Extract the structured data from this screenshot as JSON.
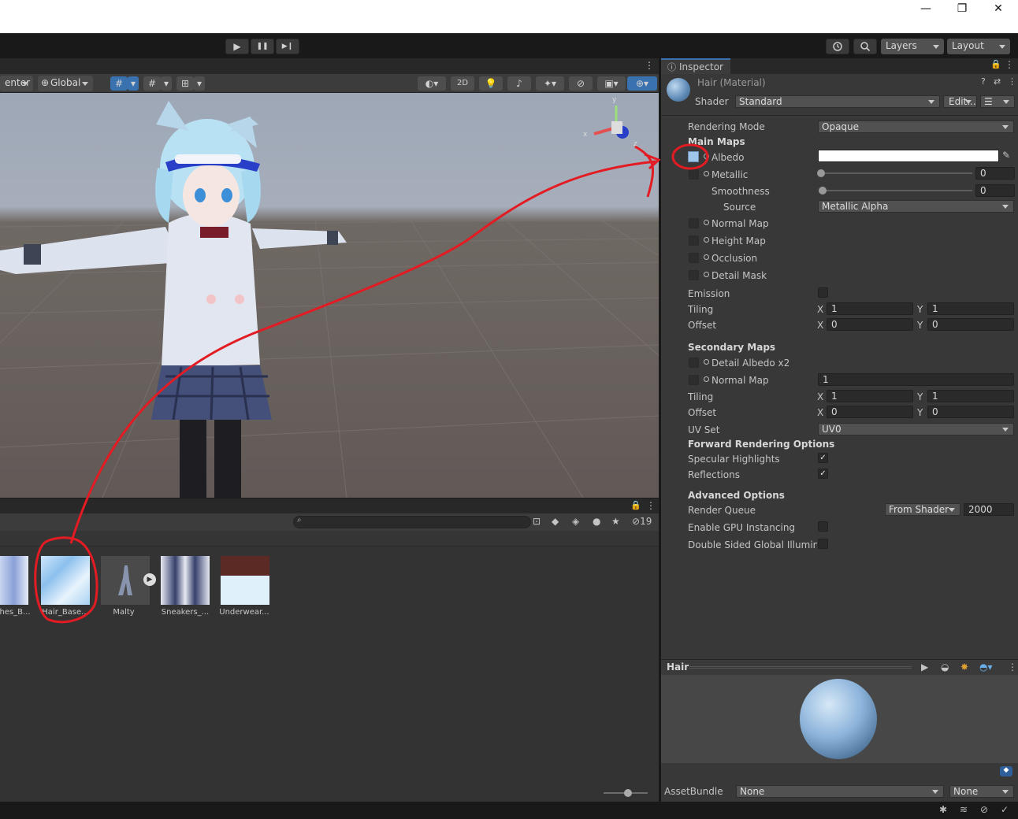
{
  "window": {
    "minimize": "—",
    "restore": "❐",
    "close": "✕"
  },
  "toolbar": {
    "play": "▶",
    "pause": "❚❚",
    "step": "▶❙",
    "history_icon": "history-icon",
    "search_icon": "search-icon",
    "layers": "Layers",
    "layout": "Layout"
  },
  "scene_toolbar": {
    "pivot": "enter",
    "global": "Global",
    "mode_2d": "2D",
    "axis_y": "y",
    "axis_x": "x",
    "axis_z": "z"
  },
  "project": {
    "search_placeholder": "",
    "hidden_count": "19",
    "assets": [
      {
        "label": "hes_B..."
      },
      {
        "label": "Hair_Base..."
      },
      {
        "label": "Malty"
      },
      {
        "label": "Sneakers_..."
      },
      {
        "label": "Underwear..."
      }
    ]
  },
  "inspector": {
    "tab": "Inspector",
    "title": "Hair (Material)",
    "shader_label": "Shader",
    "shader_value": "Standard",
    "edit_button": "Edit...",
    "rendering_mode_label": "Rendering Mode",
    "rendering_mode_value": "Opaque",
    "main_maps": "Main Maps",
    "albedo": "Albedo",
    "metallic": "Metallic",
    "metallic_value": "0",
    "smoothness": "Smoothness",
    "smoothness_value": "0",
    "source": "Source",
    "source_value": "Metallic Alpha",
    "normal_map": "Normal Map",
    "height_map": "Height Map",
    "occlusion": "Occlusion",
    "detail_mask": "Detail Mask",
    "emission": "Emission",
    "tiling": "Tiling",
    "offset": "Offset",
    "x": "X",
    "y": "Y",
    "tiling_x": "1",
    "tiling_y": "1",
    "offset_x": "0",
    "offset_y": "0",
    "secondary_maps": "Secondary Maps",
    "detail_albedo": "Detail Albedo x2",
    "normal_map_2": "Normal Map",
    "normal_map_2_value": "1",
    "tiling2_x": "1",
    "tiling2_y": "1",
    "offset2_x": "0",
    "offset2_y": "0",
    "uv_set": "UV Set",
    "uv_set_value": "UV0",
    "forward_rendering": "Forward Rendering Options",
    "specular": "Specular Highlights",
    "reflections": "Reflections",
    "advanced": "Advanced Options",
    "render_queue": "Render Queue",
    "render_queue_mode": "From Shader",
    "render_queue_value": "2000",
    "gpu_instancing": "Enable GPU Instancing",
    "double_sided": "Double Sided Global Illuminat",
    "check": "✓"
  },
  "preview": {
    "title": "Hair"
  },
  "asset_bundle": {
    "label": "AssetBundle",
    "name": "None",
    "variant": "None"
  },
  "colors": {
    "annotation": "#e31b23",
    "accent": "#3a72b0"
  }
}
